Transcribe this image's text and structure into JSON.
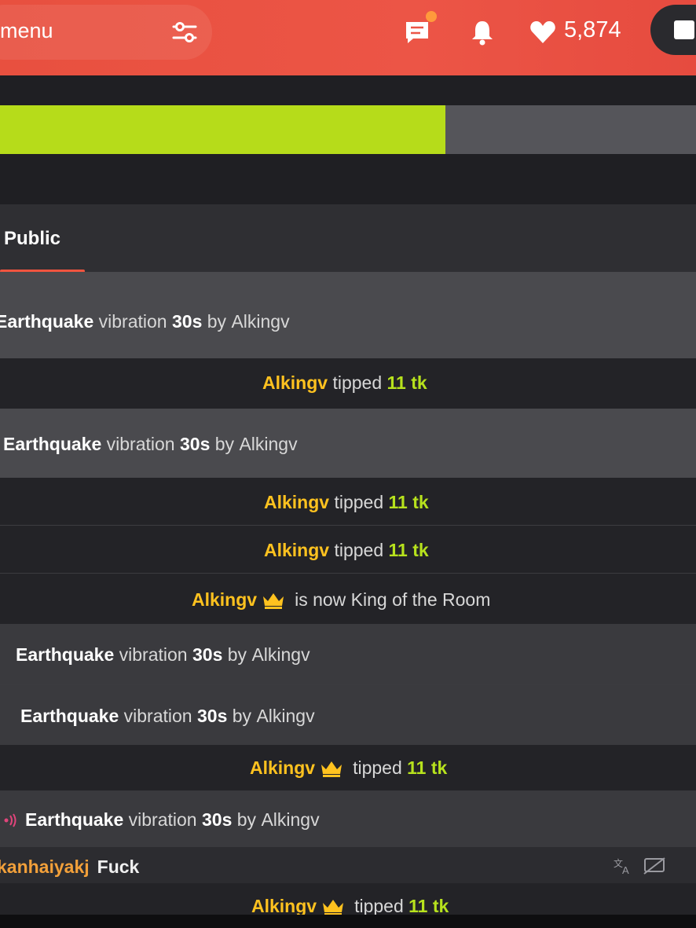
{
  "header": {
    "menu_label": "menu",
    "balance": "5,874",
    "accent_color": "#e8503f"
  },
  "goal": {
    "progress": 0.64,
    "fill_color": "#b6dc1a"
  },
  "tabs": [
    {
      "label": "Public",
      "active": true
    }
  ],
  "feed": [
    {
      "type": "vibration",
      "pattern": "Earthquake",
      "word": "vibration",
      "duration": "30s",
      "by": "by",
      "user": "Alkingv"
    },
    {
      "type": "tip",
      "user": "Alkingv",
      "action": "tipped",
      "amount": "11 tk"
    },
    {
      "type": "vibration",
      "pattern": "Earthquake",
      "word": "vibration",
      "duration": "30s",
      "by": "by",
      "user": "Alkingv"
    },
    {
      "type": "tip",
      "user": "Alkingv",
      "action": "tipped",
      "amount": "11 tk"
    },
    {
      "type": "tip",
      "user": "Alkingv",
      "action": "tipped",
      "amount": "11 tk"
    },
    {
      "type": "king",
      "user": "Alkingv",
      "text": "is now King of the Room"
    },
    {
      "type": "vibration",
      "pattern": "Earthquake",
      "word": "vibration",
      "duration": "30s",
      "by": "by",
      "user": "Alkingv"
    },
    {
      "type": "vibration",
      "pattern": "Earthquake",
      "word": "vibration",
      "duration": "30s",
      "by": "by",
      "user": "Alkingv"
    },
    {
      "type": "tip",
      "user": "Alkingv",
      "action": "tipped",
      "amount": "11 tk"
    },
    {
      "type": "vibration",
      "pattern": "Earthquake",
      "word": "vibration",
      "duration": "30s",
      "by": "by",
      "user": "Alkingv"
    },
    {
      "type": "chat",
      "user": "kanhaiyakj",
      "message": "Fuck"
    },
    {
      "type": "tip",
      "user": "Alkingv",
      "action": "tipped",
      "amount": "11 tk"
    }
  ]
}
